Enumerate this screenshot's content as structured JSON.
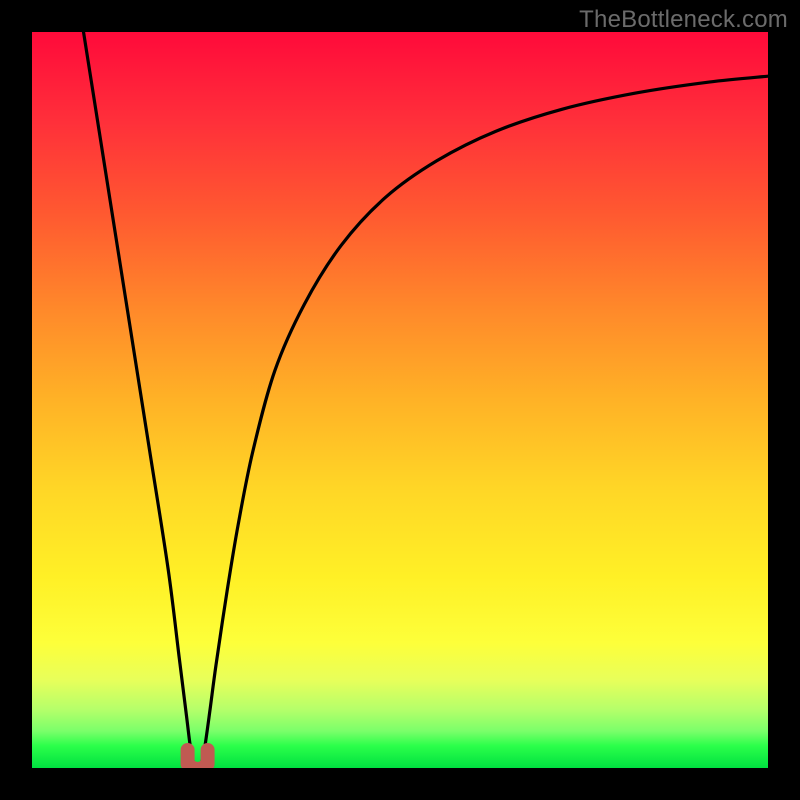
{
  "watermark": "TheBottleneck.com",
  "chart_data": {
    "type": "line",
    "title": "",
    "xlabel": "",
    "ylabel": "",
    "xlim": [
      0,
      100
    ],
    "ylim": [
      0,
      100
    ],
    "series": [
      {
        "name": "bottleneck-curve",
        "x": [
          7,
          10,
          13,
          16,
          18.5,
          20,
          21,
          21.5,
          22,
          22.5,
          23,
          23.5,
          24.2,
          25,
          26.5,
          28,
          30,
          33,
          37,
          42,
          48,
          55,
          63,
          72,
          82,
          92,
          100
        ],
        "y": [
          100,
          81,
          62,
          43,
          27,
          15,
          7,
          3,
          0.5,
          0,
          0.5,
          3,
          8,
          14,
          24,
          33,
          43,
          54,
          63,
          71,
          77.5,
          82.5,
          86.5,
          89.5,
          91.7,
          93.2,
          94
        ]
      }
    ],
    "marker": {
      "name": "optimal-point",
      "x": 22.5,
      "y": 0,
      "color": "#c05a52"
    },
    "gradient_stops": [
      {
        "pos": 0,
        "color": "#ff0a3a"
      },
      {
        "pos": 50,
        "color": "#ffb226"
      },
      {
        "pos": 83,
        "color": "#fdff3a"
      },
      {
        "pos": 100,
        "color": "#00e040"
      }
    ]
  }
}
